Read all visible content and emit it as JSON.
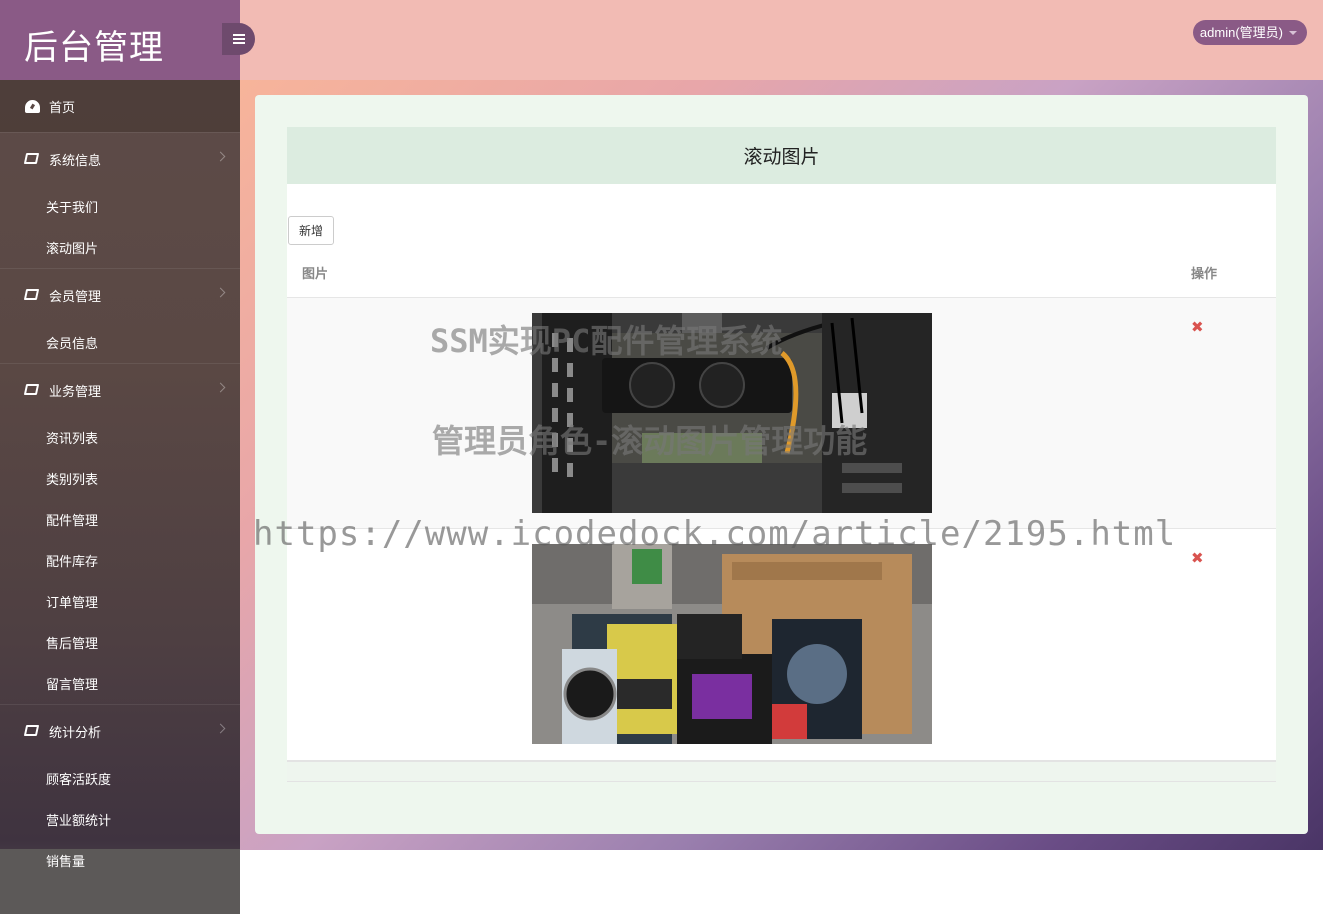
{
  "app": {
    "title": "后台管理",
    "user_label": "admin(管理员)"
  },
  "sidebar": {
    "home": {
      "label": "首页",
      "icon": "dashboard-icon"
    },
    "groups": [
      {
        "label": "系统信息",
        "icon": "book-icon",
        "items": [
          "关于我们",
          "滚动图片"
        ]
      },
      {
        "label": "会员管理",
        "icon": "book-icon",
        "items": [
          "会员信息"
        ]
      },
      {
        "label": "业务管理",
        "icon": "book-icon",
        "items": [
          "资讯列表",
          "类别列表",
          "配件管理",
          "配件库存",
          "订单管理",
          "售后管理",
          "留言管理"
        ]
      },
      {
        "label": "统计分析",
        "icon": "book-icon",
        "items": [
          "顾客活跃度",
          "营业额统计",
          "销售量"
        ]
      }
    ]
  },
  "main": {
    "card_title": "滚动图片",
    "add_button": "新增",
    "columns": [
      "图片",
      "操作"
    ],
    "rows": [
      {
        "image": "graphics-card-in-pc-case-photo",
        "action_icon": "delete-icon"
      },
      {
        "image": "pc-components-boxes-photo",
        "action_icon": "delete-icon"
      }
    ]
  },
  "watermark": {
    "line1": "SSM实现PC配件管理系统",
    "line2": "管理员角色-滚动图片管理功能",
    "url": "https://www.icodedock.com/article/2195.html"
  },
  "colors": {
    "sidebar_logo": "#8a5a86",
    "topbar": "#f2bbb4",
    "card_header": "#dcece0",
    "delete": "#d9534f"
  }
}
